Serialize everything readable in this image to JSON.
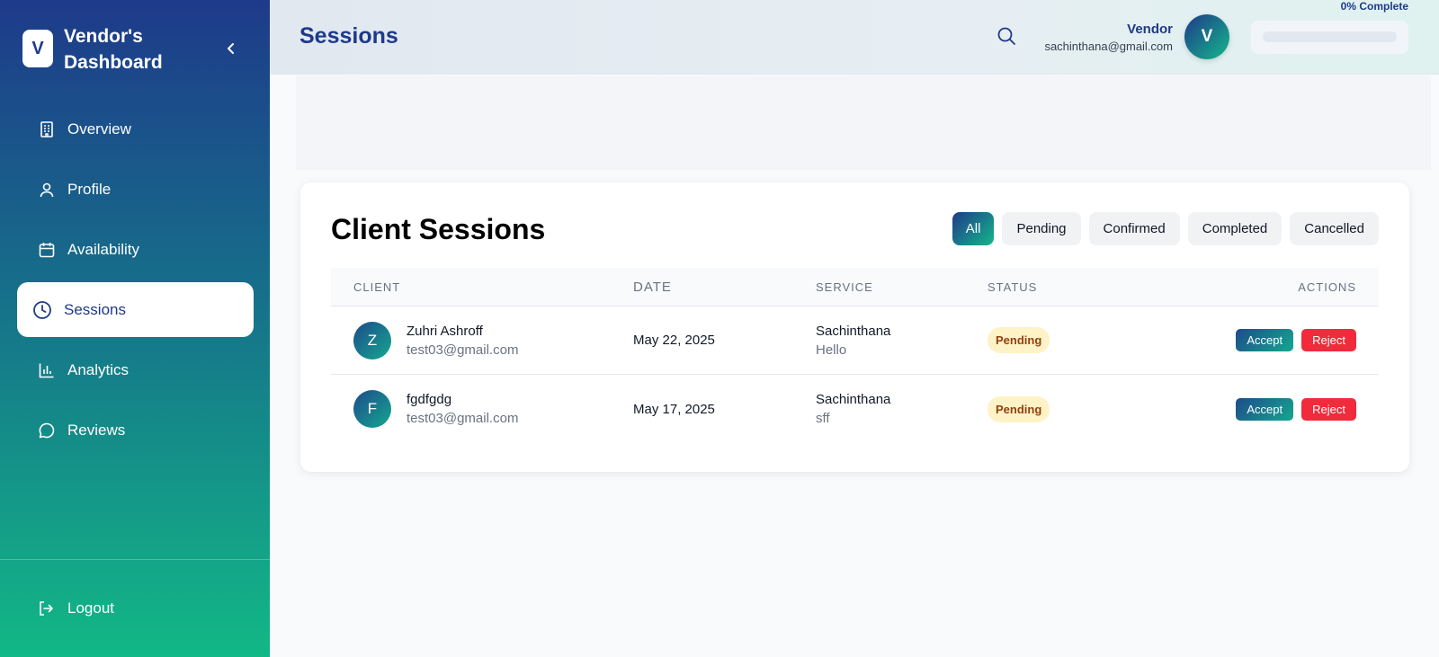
{
  "sidebar": {
    "logo_letter": "V",
    "brand": "Vendor's Dashboard",
    "items": [
      {
        "label": "Overview",
        "icon": "building-icon"
      },
      {
        "label": "Profile",
        "icon": "user-icon"
      },
      {
        "label": "Availability",
        "icon": "calendar-icon"
      },
      {
        "label": "Sessions",
        "icon": "clock-icon"
      },
      {
        "label": "Analytics",
        "icon": "bar-chart-icon"
      },
      {
        "label": "Reviews",
        "icon": "chat-bubble-icon"
      }
    ],
    "active_item": "Sessions",
    "logout_label": "Logout"
  },
  "header": {
    "title": "Sessions",
    "user_name": "Vendor",
    "user_email": "sachinthana@gmail.com",
    "avatar_letter": "V",
    "progress_label": "0% Complete",
    "progress_fraction": 0
  },
  "sessions": {
    "title": "Client Sessions",
    "filters": [
      "All",
      "Pending",
      "Confirmed",
      "Completed",
      "Cancelled"
    ],
    "active_filter": "All",
    "columns": [
      "CLIENT",
      "DATE",
      "SERVICE",
      "STATUS",
      "ACTIONS"
    ],
    "rows": [
      {
        "avatar": "Z",
        "name": "Zuhri Ashroff",
        "email": "test03@gmail.com",
        "date": "May 22, 2025",
        "service": "Sachinthana",
        "note": "Hello",
        "status": "Pending",
        "accept": "Accept",
        "reject": "Reject"
      },
      {
        "avatar": "F",
        "name": "fgdfgdg",
        "email": "test03@gmail.com",
        "date": "May 17, 2025",
        "service": "Sachinthana",
        "note": "sff",
        "status": "Pending",
        "accept": "Accept",
        "reject": "Reject"
      }
    ]
  },
  "colors": {
    "primary": "#1e3a8a",
    "accent": "#14b88a",
    "pending_bg": "#fef3c7",
    "reject": "#ef2b3c"
  }
}
